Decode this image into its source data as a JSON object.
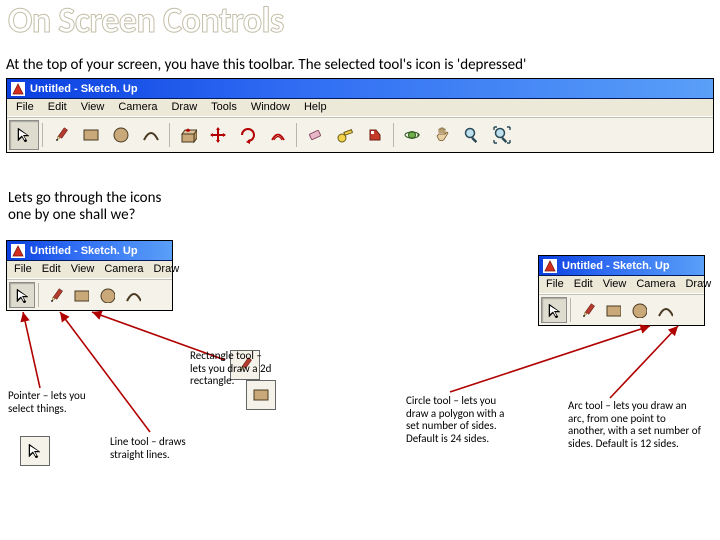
{
  "title": "On Screen Controls",
  "intro": "At the top of your screen, you have this toolbar.  The selected tool's icon is 'depressed'",
  "lead_l1": "Lets go through the icons",
  "lead_l2": "one by one shall we?",
  "app_title": "Untitled - Sketch. Up",
  "menus_full": {
    "file": "File",
    "edit": "Edit",
    "view": "View",
    "camera": "Camera",
    "draw": "Draw",
    "tools": "Tools",
    "window": "Window",
    "help": "Help"
  },
  "menus_short": {
    "file": "File",
    "edit": "Edit",
    "view": "View",
    "camera": "Camera",
    "draw": "Draw"
  },
  "notes": {
    "pointer": "Pointer – lets you select things.",
    "line": "Line tool – draws straight lines.",
    "rect": "Rectangle tool – lets you draw a 2d rectangle.",
    "circle": "Circle tool – lets you draw a polygon with a set number of sides.  Default is 24 sides.",
    "arc": "Arc tool – lets you draw an arc, from one point to another, with a set number of sides.  Default is 12 sides."
  }
}
